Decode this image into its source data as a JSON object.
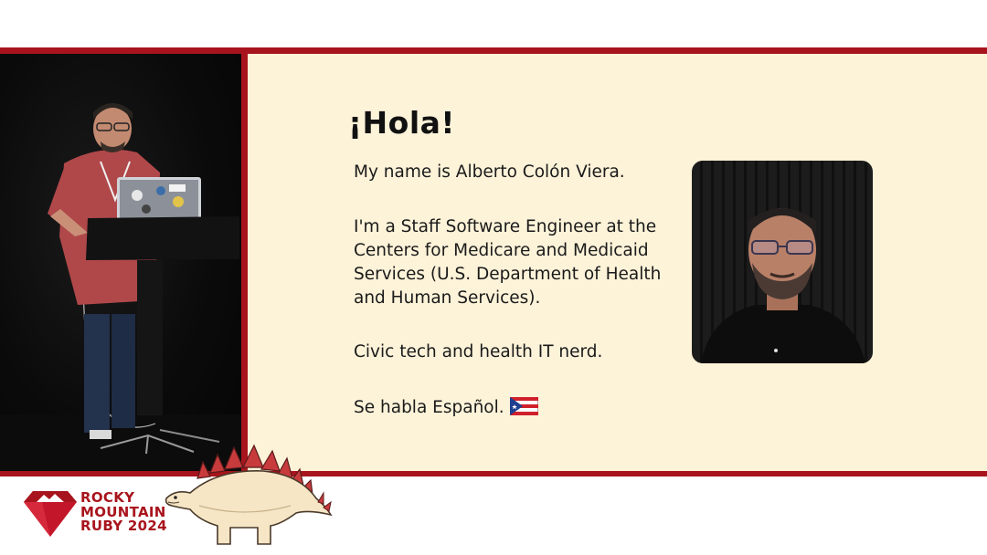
{
  "slide": {
    "heading": "¡Hola!",
    "paragraphs": [
      "My name is Alberto Colón Viera.",
      "I'm a Staff Software Engineer at the Centers for Medicare and Medicaid Services (U.S. Department of Health and Human Services).",
      "Civic tech and health IT nerd.",
      "Se habla Español."
    ],
    "flag_icon": "puerto-rico-flag-icon"
  },
  "branding": {
    "line1": "ROCKY",
    "line2": "MOUNTAIN",
    "line3": "RUBY 2024",
    "logo_icon": "ruby-mountain-gem-icon",
    "mascot_icon": "stegosaurus-mascot-icon"
  },
  "colors": {
    "frame_red": "#a8141d",
    "slide_background": "#fdf3d9",
    "text": "#1a1a1a"
  }
}
